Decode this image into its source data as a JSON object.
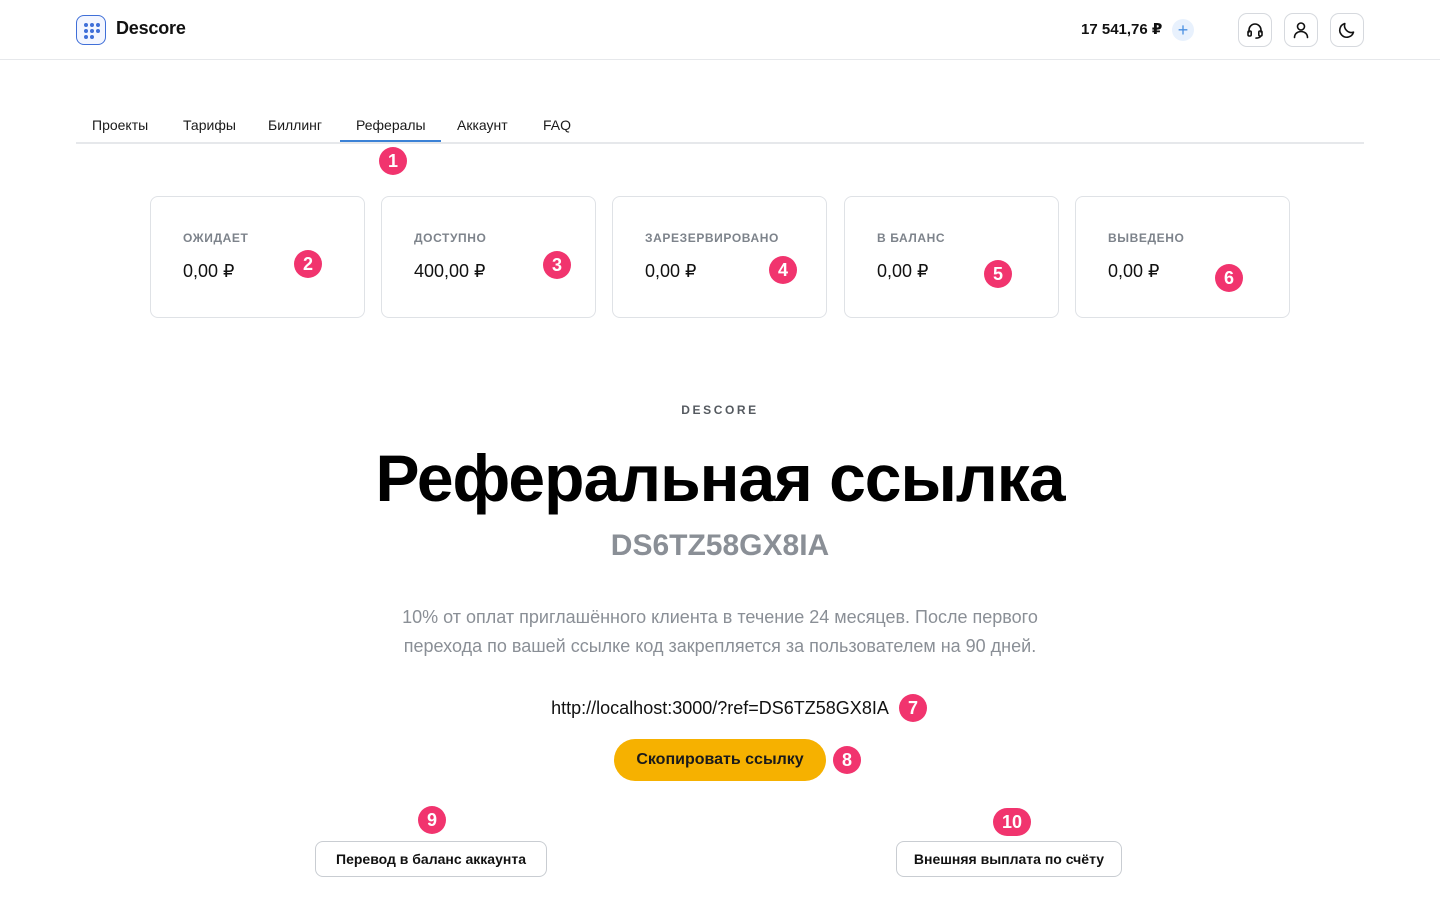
{
  "header": {
    "brand": "Descore",
    "balance": "17 541,76 ₽",
    "add_symbol": "+",
    "icons": [
      "headset-icon",
      "user-icon",
      "moon-icon"
    ]
  },
  "tabs": [
    {
      "label": "Проекты",
      "active": false
    },
    {
      "label": "Тарифы",
      "active": false
    },
    {
      "label": "Биллинг",
      "active": false
    },
    {
      "label": "Рефералы",
      "active": true
    },
    {
      "label": "Аккаунт",
      "active": false
    },
    {
      "label": "FAQ",
      "active": false
    }
  ],
  "stats": [
    {
      "label": "ОЖИДАЕТ",
      "value": "0,00 ₽"
    },
    {
      "label": "ДОСТУПНО",
      "value": "400,00 ₽"
    },
    {
      "label": "ЗАРЕЗЕРВИРОВАНО",
      "value": "0,00 ₽"
    },
    {
      "label": "В БАЛАНС",
      "value": "0,00 ₽"
    },
    {
      "label": "ВЫВЕДЕНО",
      "value": "0,00 ₽"
    }
  ],
  "hero": {
    "eyebrow": "DESCORE",
    "title": "Реферальная ссылка",
    "code": "DS6TZ58GX8IA",
    "description": "10% от оплат приглашённого клиента в течение 24 месяцев. После первого перехода по вашей ссылке код закрепляется за пользователем на 90 дней.",
    "link": "http://localhost:3000/?ref=DS6TZ58GX8IA",
    "copy_label": "Скопировать ссылку"
  },
  "actions": {
    "transfer_label": "Перевод в баланс аккаунта",
    "payout_label": "Внешняя выплата по счёту"
  },
  "markers": [
    "1",
    "2",
    "3",
    "4",
    "5",
    "6",
    "7",
    "8",
    "9",
    "10"
  ],
  "colors": {
    "accent": "#3b82d6",
    "copy_button": "#f6b100",
    "marker": "#f1346e",
    "muted_text": "#8a8f96"
  }
}
